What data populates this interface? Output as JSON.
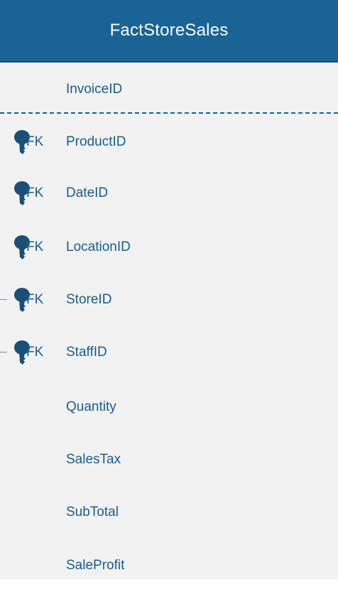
{
  "entity": {
    "title": "FactStoreSales",
    "primary_fields": [
      {
        "name": "InvoiceID",
        "key": ""
      }
    ],
    "fields": [
      {
        "name": "ProductID",
        "key": "FK"
      },
      {
        "name": "DateID",
        "key": "FK"
      },
      {
        "name": "LocationID",
        "key": "FK"
      },
      {
        "name": "StoreID",
        "key": "FK"
      },
      {
        "name": "StaffID",
        "key": "FK"
      },
      {
        "name": "Quantity",
        "key": ""
      },
      {
        "name": "SalesTax",
        "key": ""
      },
      {
        "name": "SubTotal",
        "key": ""
      },
      {
        "name": "SaleProfit",
        "key": ""
      }
    ]
  },
  "colors": {
    "header_bg": "#1a6396",
    "body_bg": "#f2f2f2",
    "field_text": "#185d8f",
    "key_icon": "#1b4f77"
  },
  "icons": {
    "foreign_key": "key-icon"
  }
}
